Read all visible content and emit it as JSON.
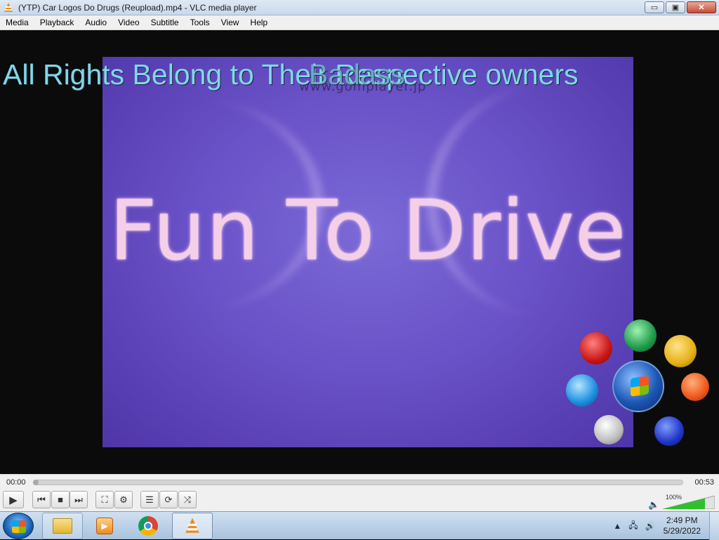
{
  "window": {
    "title": "(YTP) Car Logos Do Drugs (Reupload).mp4 - VLC media player",
    "minimize_label": "▭",
    "maximize_label": "▣",
    "close_label": "✕"
  },
  "menu": [
    "Media",
    "Playback",
    "Audio",
    "Video",
    "Subtitle",
    "Tools",
    "View",
    "Help"
  ],
  "video": {
    "overlay_text": "All Rights Belong to Their Respective owners",
    "overlay_text_ghost": "Badass",
    "watermark": "www.gomplayer.jp",
    "main_text": "Fun To Drive"
  },
  "player": {
    "elapsed": "00:00",
    "total": "00:53",
    "progress": 0,
    "volume": "100%",
    "volume_level": 1.0,
    "buttons": {
      "play": "▶",
      "prev": "⏮",
      "stop": "■",
      "next": "⏭",
      "fullscreen": "⛶",
      "extended": "⚙",
      "playlist": "☰",
      "loop": "⟳",
      "shuffle": "⤨"
    }
  },
  "taskbar": {
    "time": "2:49 PM",
    "date": "5/29/2022",
    "tray_up": "▲",
    "tray_network": "🖧",
    "tray_volume": "🔊"
  },
  "colors": {
    "video_bg": "#6a52c8",
    "overlay_text": "#7fd8e6",
    "main_text": "#f4cfe7",
    "volume_green": "#2fbf2f"
  }
}
